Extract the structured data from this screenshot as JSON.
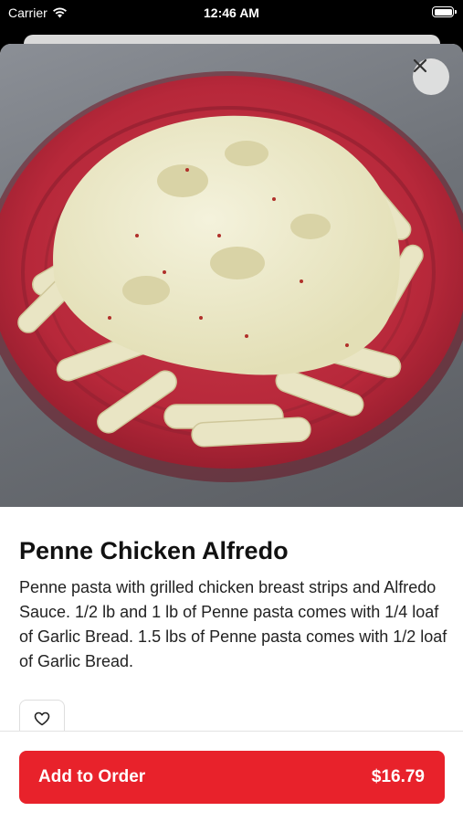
{
  "status_bar": {
    "carrier": "Carrier",
    "time": "12:46 AM"
  },
  "item": {
    "name": "Penne Chicken Alfredo",
    "description": "Penne pasta with grilled chicken breast strips and Alfredo Sauce. 1/2 lb and 1 lb  of Penne pasta comes with 1/4 loaf of Garlic Bread. 1.5 lbs of Penne pasta comes with 1/2 loaf of Garlic Bread."
  },
  "footer": {
    "add_label": "Add to Order",
    "price": "$16.79"
  },
  "icons": {
    "close": "close-icon",
    "favorite": "heart-outline-icon",
    "wifi": "wifi-icon",
    "battery": "battery-icon"
  },
  "colors": {
    "accent": "#e8222b",
    "plate": "#b7283a"
  }
}
